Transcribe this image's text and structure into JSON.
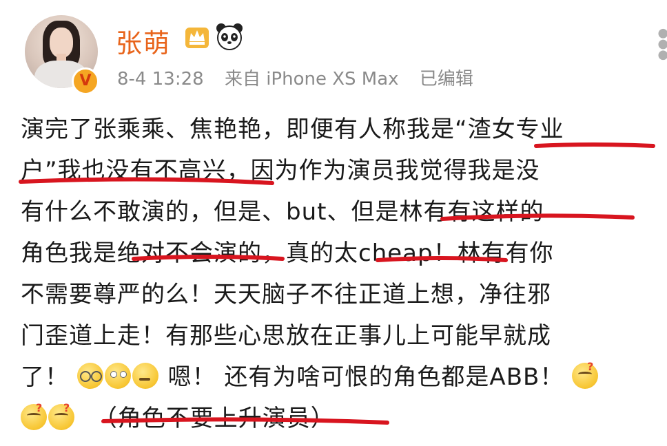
{
  "user": {
    "name": "张萌",
    "badge_letter": "V"
  },
  "meta": {
    "time": "8-4 13:28",
    "source": "来自 iPhone XS Max",
    "edited": "已编辑"
  },
  "post": {
    "line1": "演完了张乘乘、焦艳艳，即便有人称我是“渣女专业",
    "line2": "户”我也没有不高兴，因为作为演员我觉得我是没",
    "line3": "有什么不敢演的，但是、but、但是林有有这样的",
    "line4": "角色我是绝对不会演的，真的太cheap！林有有你",
    "line5": "不需要尊严的么！天天脑子不往正道上想，净往邪",
    "line6": "门歪道上走！有那些心思放在正事儿上可能早就成",
    "line7a": "了！",
    "line7b": "嗯！ 还有为啥可恨的角色都是ABB！",
    "line8b": "（角色不要上升演员）"
  },
  "icons": [
    "avatar",
    "verified-badge",
    "crown-icon",
    "panda-icon",
    "more-icon",
    "glasses-emoji-icon",
    "eye-roll-emoji-icon",
    "thinking-emoji-icon"
  ],
  "colors": {
    "name": "#e8641b",
    "meta": "#8a8a8a",
    "underline": "#d8151f",
    "badge": "#f5a623"
  }
}
